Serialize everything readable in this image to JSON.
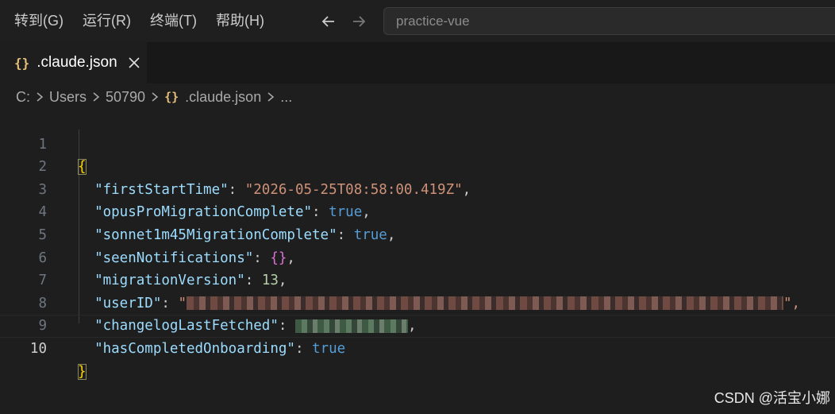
{
  "menu": {
    "items": [
      "转到(G)",
      "运行(R)",
      "终端(T)",
      "帮助(H)"
    ]
  },
  "search": {
    "placeholder": "practice-vue"
  },
  "tab": {
    "icon": "{}",
    "label": ".claude.json"
  },
  "breadcrumb": {
    "parts": [
      "C:",
      "Users",
      "50790"
    ],
    "file_icon": "{}",
    "file": ".claude.json",
    "more": "..."
  },
  "editor": {
    "line_numbers": [
      "1",
      "2",
      "3",
      "4",
      "5",
      "6",
      "7",
      "8",
      "9",
      "10"
    ],
    "lines": [
      {
        "open": "{"
      },
      {
        "key": "\"firstStartTime\"",
        "value": "\"2026-05-25T08:58:00.419Z\"",
        "vtype": "str",
        "comma": ","
      },
      {
        "key": "\"opusProMigrationComplete\"",
        "value": "true",
        "vtype": "bool",
        "comma": ","
      },
      {
        "key": "\"sonnet1m45MigrationComplete\"",
        "value": "true",
        "vtype": "bool",
        "comma": ","
      },
      {
        "key": "\"seenNotifications\"",
        "value": "{}",
        "vtype": "obj",
        "comma": ","
      },
      {
        "key": "\"migrationVersion\"",
        "value": "13",
        "vtype": "num",
        "comma": ","
      },
      {
        "key": "\"userID\"",
        "value": "\"",
        "vtype": "redacted",
        "comma": "\","
      },
      {
        "key": "\"changelogLastFetched\"",
        "value": "",
        "vtype": "redacted2",
        "comma": ","
      },
      {
        "key": "\"hasCompletedOnboarding\"",
        "value": "true",
        "vtype": "bool",
        "comma": ""
      },
      {
        "close": "}"
      }
    ]
  },
  "watermark": "CSDN @活宝小娜",
  "colors": {
    "key": "#9cdcfe",
    "string": "#ce9178",
    "boolean": "#569cd6",
    "number": "#b5cea8",
    "brace": "#ffd700",
    "brace_nested": "#da70d6"
  }
}
